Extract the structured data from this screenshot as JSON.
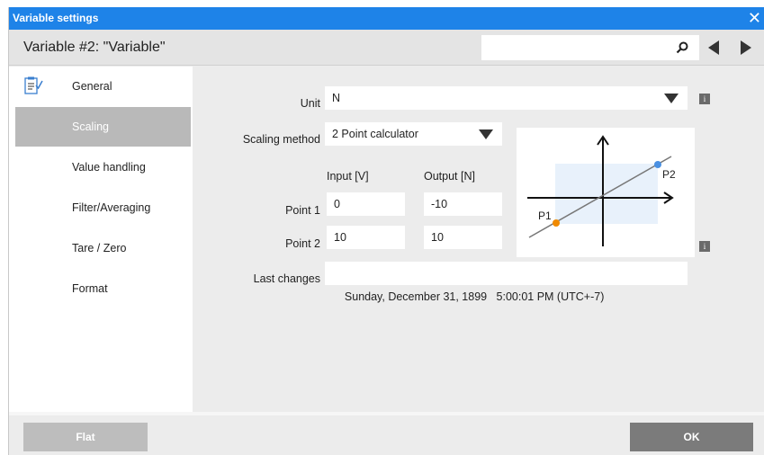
{
  "window": {
    "title": "Variable settings",
    "close_glyph": "✕"
  },
  "header": {
    "variable_title": "Variable #2: \"Variable\"",
    "search_value": ""
  },
  "sidebar": {
    "items": [
      {
        "label": "General"
      },
      {
        "label": "Scaling"
      },
      {
        "label": "Value handling"
      },
      {
        "label": "Filter/Averaging"
      },
      {
        "label": "Tare / Zero"
      },
      {
        "label": "Format"
      }
    ],
    "active_index": 1
  },
  "scaling": {
    "unit_label": "Unit",
    "unit_value": "N",
    "method_label": "Scaling method",
    "method_value": "2 Point calculator",
    "input_header": "Input [V]",
    "output_header": "Output [N]",
    "point1_label": "Point 1",
    "point1_input": "0",
    "point1_output": "-10",
    "point2_label": "Point 2",
    "point2_input": "10",
    "point2_output": "10",
    "last_changes_label": "Last changes",
    "last_changes_value": "Sunday, December 31, 1899   5:00:01 PM (UTC+-7)",
    "info_glyph": "i"
  },
  "graph": {
    "p1_label": "P1",
    "p2_label": "P2",
    "p1_color": "#f08a00",
    "p2_color": "#4a90e2",
    "highlight_color": "#e8f1fb"
  },
  "footer": {
    "flat_label": "Flat",
    "ok_label": "OK"
  },
  "colors": {
    "titlebar": "#1e83e8",
    "active_item": "#b9b9b9",
    "ok_button": "#7b7b7b",
    "flat_button": "#bdbdbd"
  }
}
